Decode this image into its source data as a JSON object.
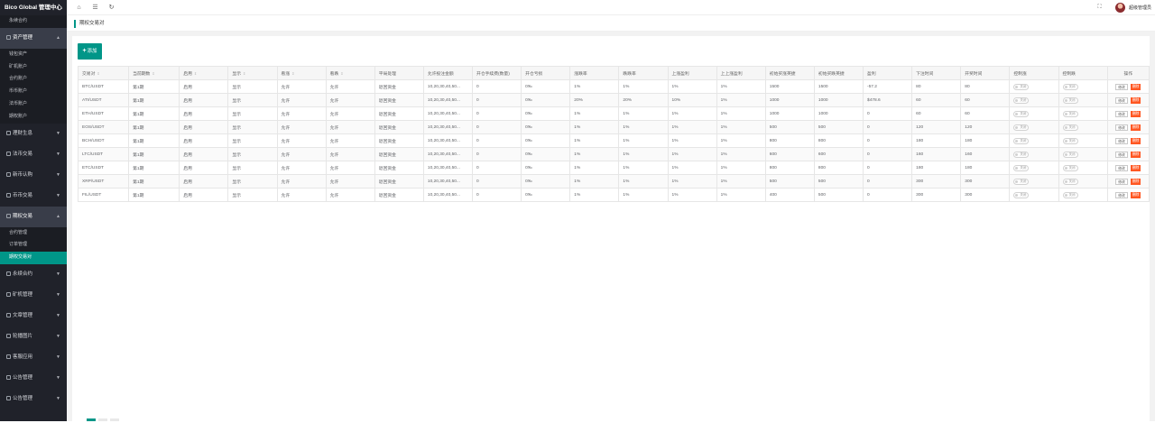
{
  "brand": "Bico Global 管理中心",
  "sidebar": {
    "groups": [
      {
        "label": "永续合约",
        "type": "sub-only"
      },
      {
        "label": "资产管理",
        "expanded": true,
        "children": [
          "钱包资产",
          "矿机账户",
          "合约账户",
          "币币账户",
          "法币账户",
          "期权账户"
        ]
      },
      {
        "label": "理财生息",
        "expanded": false
      },
      {
        "label": "法币交易",
        "expanded": false
      },
      {
        "label": "新币认购",
        "expanded": false
      },
      {
        "label": "币币交易",
        "expanded": false
      },
      {
        "label": "期权交易",
        "expanded": true,
        "children": [
          "合约管理",
          "订单管理",
          "期权交易对"
        ],
        "current": "期权交易对"
      },
      {
        "label": "永续合约",
        "expanded": false
      },
      {
        "label": "矿机管理",
        "expanded": false
      },
      {
        "label": "文章管理",
        "expanded": false
      },
      {
        "label": "轮播图片",
        "expanded": false
      },
      {
        "label": "客服应用",
        "expanded": false
      },
      {
        "label": "公告管理",
        "expanded": false
      },
      {
        "label": "公告管理",
        "expanded": false
      }
    ]
  },
  "header": {
    "admin_name": "超级管理员"
  },
  "tab": {
    "label": "期权交易对"
  },
  "toolbar": {
    "add_label": "添加"
  },
  "table": {
    "columns": [
      "交易对",
      "当前期数",
      "启用",
      "显示",
      "看涨",
      "看跌",
      "平局处理",
      "允许投注金额",
      "开仓手续费(数量)",
      "开仓亏损",
      "涨跌率",
      "跌跌率",
      "上涨盈利",
      "上上涨盈利",
      "初始买涨英捷",
      "初始买跌英捷",
      "盈利",
      "下注时间",
      "开奖时间",
      "控制涨",
      "控制跌",
      "操作"
    ],
    "switch_label": "关闭",
    "edit_label": "修改",
    "delete_label": "删除",
    "rows": [
      [
        "BTC/USDT",
        "第1期",
        "启用",
        "显示",
        "允许",
        "允许",
        "退回资金",
        "10,20,30,40,50...",
        "0",
        "0‰",
        "1%",
        "1%",
        "1%",
        "1%",
        "1500",
        "1500",
        "-57.2",
        "80",
        "80"
      ],
      [
        "ATI/USDT",
        "第1期",
        "启用",
        "显示",
        "允许",
        "允许",
        "退回资金",
        "10,20,30,40,50...",
        "0",
        "0‰",
        "20%",
        "20%",
        "10%",
        "1%",
        "1000",
        "1000",
        "$478.6",
        "60",
        "60"
      ],
      [
        "ETH/USDT",
        "第1期",
        "启用",
        "显示",
        "允许",
        "允许",
        "退回资金",
        "10,20,30,40,50...",
        "0",
        "0‰",
        "1%",
        "1%",
        "1%",
        "1%",
        "1000",
        "1000",
        "0",
        "60",
        "60"
      ],
      [
        "EOS/USDT",
        "第1期",
        "启用",
        "显示",
        "允许",
        "允许",
        "退回资金",
        "10,20,30,40,50...",
        "0",
        "0‰",
        "1%",
        "1%",
        "1%",
        "1%",
        "500",
        "500",
        "0",
        "120",
        "120"
      ],
      [
        "BCH/USDT",
        "第1期",
        "启用",
        "显示",
        "允许",
        "允许",
        "退回资金",
        "10,20,30,40,50...",
        "0",
        "0‰",
        "1%",
        "1%",
        "1%",
        "1%",
        "800",
        "800",
        "0",
        "180",
        "180"
      ],
      [
        "LTC/USDT",
        "第1期",
        "启用",
        "显示",
        "允许",
        "允许",
        "退回资金",
        "10,20,30,40,50...",
        "0",
        "0‰",
        "1%",
        "1%",
        "1%",
        "1%",
        "600",
        "600",
        "0",
        "160",
        "160"
      ],
      [
        "ETC/USDT",
        "第1期",
        "启用",
        "显示",
        "允许",
        "允许",
        "退回资金",
        "10,20,30,40,50...",
        "0",
        "0‰",
        "1%",
        "1%",
        "1%",
        "1%",
        "800",
        "800",
        "0",
        "180",
        "180"
      ],
      [
        "XRP/USDT",
        "第1期",
        "启用",
        "显示",
        "允许",
        "允许",
        "退回资金",
        "10,20,30,40,50...",
        "0",
        "0‰",
        "1%",
        "1%",
        "1%",
        "1%",
        "500",
        "500",
        "0",
        "300",
        "300"
      ],
      [
        "FIL/USDT",
        "第1期",
        "启用",
        "显示",
        "允许",
        "允许",
        "退回资金",
        "10,20,30,40,50...",
        "0",
        "0‰",
        "1%",
        "1%",
        "1%",
        "1%",
        "400",
        "500",
        "0",
        "300",
        "300"
      ]
    ]
  }
}
